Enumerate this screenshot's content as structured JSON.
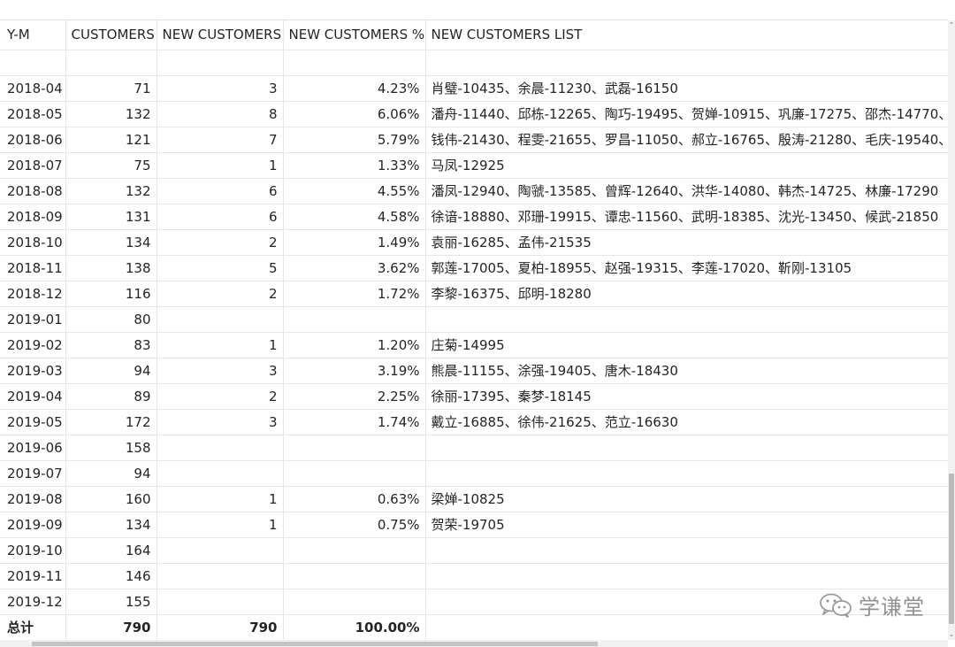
{
  "table": {
    "headers": {
      "ym": "Y-M",
      "customers": "CUSTOMERS",
      "new_customers": "NEW CUSTOMERS",
      "new_customers_pct": "NEW CUSTOMERS %",
      "new_customers_list": "NEW CUSTOMERS LIST"
    },
    "rows": [
      {
        "ym": "2018-04",
        "customers": "71",
        "new": "3",
        "pct": "4.23%",
        "list": "肖璧-10435、余晨-11230、武磊-16150"
      },
      {
        "ym": "2018-05",
        "customers": "132",
        "new": "8",
        "pct": "6.06%",
        "list": "潘舟-11440、邱栋-12265、陶巧-19495、贺婵-10915、巩廉-17275、邵杰-14770、"
      },
      {
        "ym": "2018-06",
        "customers": "121",
        "new": "7",
        "pct": "5.79%",
        "list": "钱伟-21430、程雯-21655、罗昌-11050、郝立-16765、殷涛-21280、毛庆-19540、"
      },
      {
        "ym": "2018-07",
        "customers": "75",
        "new": "1",
        "pct": "1.33%",
        "list": "马凤-12925"
      },
      {
        "ym": "2018-08",
        "customers": "132",
        "new": "6",
        "pct": "4.55%",
        "list": "潘凤-12940、陶虢-13585、曾辉-12640、洪华-14080、韩杰-14725、林廉-17290"
      },
      {
        "ym": "2018-09",
        "customers": "131",
        "new": "6",
        "pct": "4.58%",
        "list": "徐谙-18880、邓珊-19915、谭忠-11560、武明-18385、沈光-13450、候武-21850"
      },
      {
        "ym": "2018-10",
        "customers": "134",
        "new": "2",
        "pct": "1.49%",
        "list": "袁丽-16285、孟伟-21535"
      },
      {
        "ym": "2018-11",
        "customers": "138",
        "new": "5",
        "pct": "3.62%",
        "list": "郭莲-17005、夏柏-18955、赵强-19315、李莲-17020、靳刚-13105"
      },
      {
        "ym": "2018-12",
        "customers": "116",
        "new": "2",
        "pct": "1.72%",
        "list": "李黎-16375、邱明-18280"
      },
      {
        "ym": "2019-01",
        "customers": "80",
        "new": "",
        "pct": "",
        "list": ""
      },
      {
        "ym": "2019-02",
        "customers": "83",
        "new": "1",
        "pct": "1.20%",
        "list": "庄菊-14995"
      },
      {
        "ym": "2019-03",
        "customers": "94",
        "new": "3",
        "pct": "3.19%",
        "list": "熊晨-11155、涂强-19405、唐木-18430"
      },
      {
        "ym": "2019-04",
        "customers": "89",
        "new": "2",
        "pct": "2.25%",
        "list": "徐丽-17395、秦梦-18145"
      },
      {
        "ym": "2019-05",
        "customers": "172",
        "new": "3",
        "pct": "1.74%",
        "list": "戴立-16885、徐伟-21625、范立-16630"
      },
      {
        "ym": "2019-06",
        "customers": "158",
        "new": "",
        "pct": "",
        "list": ""
      },
      {
        "ym": "2019-07",
        "customers": "94",
        "new": "",
        "pct": "",
        "list": ""
      },
      {
        "ym": "2019-08",
        "customers": "160",
        "new": "1",
        "pct": "0.63%",
        "list": "梁婵-10825"
      },
      {
        "ym": "2019-09",
        "customers": "134",
        "new": "1",
        "pct": "0.75%",
        "list": "贺荣-19705"
      },
      {
        "ym": "2019-10",
        "customers": "164",
        "new": "",
        "pct": "",
        "list": ""
      },
      {
        "ym": "2019-11",
        "customers": "146",
        "new": "",
        "pct": "",
        "list": ""
      },
      {
        "ym": "2019-12",
        "customers": "155",
        "new": "",
        "pct": "",
        "list": ""
      }
    ],
    "total": {
      "ym": "总计",
      "customers": "790",
      "new": "790",
      "pct": "100.00%",
      "list": ""
    }
  },
  "watermark": {
    "text": "学谦堂",
    "icon": "wechat-icon"
  },
  "scrollbars": {
    "up_arrow": "⌃",
    "down_arrow": "⌄"
  }
}
